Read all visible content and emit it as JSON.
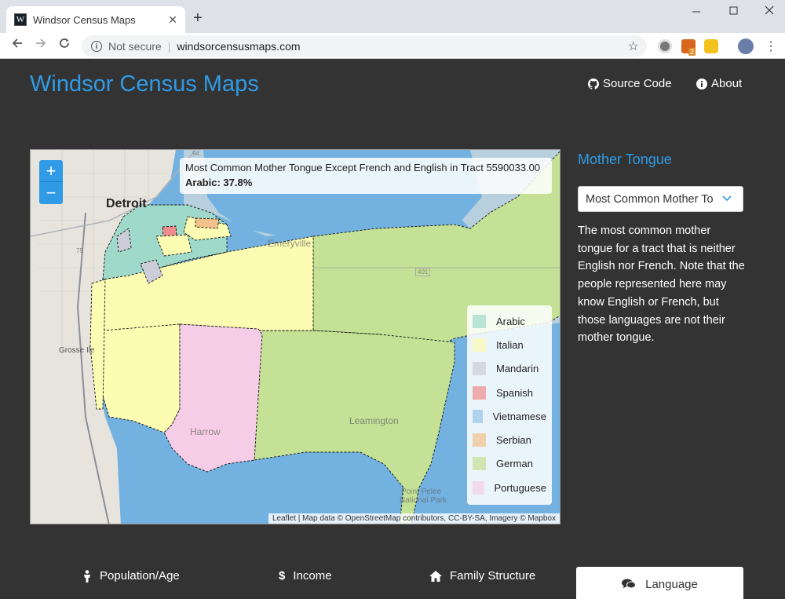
{
  "browser": {
    "tab_title": "Windsor Census Maps",
    "tab_favicon_letter": "W",
    "close_tab_glyph": "✕",
    "new_tab_glyph": "+",
    "security_label": "Not secure",
    "url": "windsorcensusmaps.com",
    "extension_badge": "2"
  },
  "header": {
    "brand": "Windsor Census Maps",
    "links": [
      {
        "label": "Source Code",
        "icon": "github-icon"
      },
      {
        "label": "About",
        "icon": "info-circle-icon"
      }
    ]
  },
  "map": {
    "zoom_in": "+",
    "zoom_out": "−",
    "info_title": "Most Common Mother Tongue Except French and English in Tract 5590033.00",
    "info_value": "Arabic: 37.8%",
    "place_labels": {
      "detroit": "Detroit",
      "grosse_ile": "Grosse Ile",
      "emeryville": "Emeryville",
      "harrow": "Harrow",
      "leamington": "Leamington",
      "point_pelee": "Point Pelee",
      "national_park": "National Park",
      "road_401": "401",
      "road_75": "75",
      "road_94": "94"
    },
    "legend": [
      {
        "label": "Arabic",
        "color": "#9fd9c9"
      },
      {
        "label": "Italian",
        "color": "#fcfcb2"
      },
      {
        "label": "Mandarin",
        "color": "#cccdd9"
      },
      {
        "label": "Spanish",
        "color": "#f08c8c"
      },
      {
        "label": "Vietnamese",
        "color": "#93c6e6"
      },
      {
        "label": "Serbian",
        "color": "#f2c08a"
      },
      {
        "label": "German",
        "color": "#c4e196"
      },
      {
        "label": "Portuguese",
        "color": "#f5cde6"
      }
    ],
    "attribution": "Leaflet | Map data © OpenStreetMap contributors, CC-BY-SA, Imagery © Mapbox"
  },
  "sidebar": {
    "title": "Mother Tongue",
    "select_value": "Most Common Mother Tongue",
    "description": "The most common mother tongue for a tract that is neither English nor French. Note that the people represented here may know English or French, but those languages are not their mother tongue."
  },
  "bottom_nav": [
    {
      "label": "Population/Age",
      "icon": "person-icon"
    },
    {
      "label": "Income",
      "icon": "dollar-icon"
    },
    {
      "label": "Family Structure",
      "icon": "home-icon"
    },
    {
      "label": "Language",
      "icon": "comments-icon"
    }
  ],
  "colors": {
    "accent": "#2f9be6",
    "page_bg": "#333333",
    "water": "#73b2e0",
    "land": "#e6e4dc"
  }
}
